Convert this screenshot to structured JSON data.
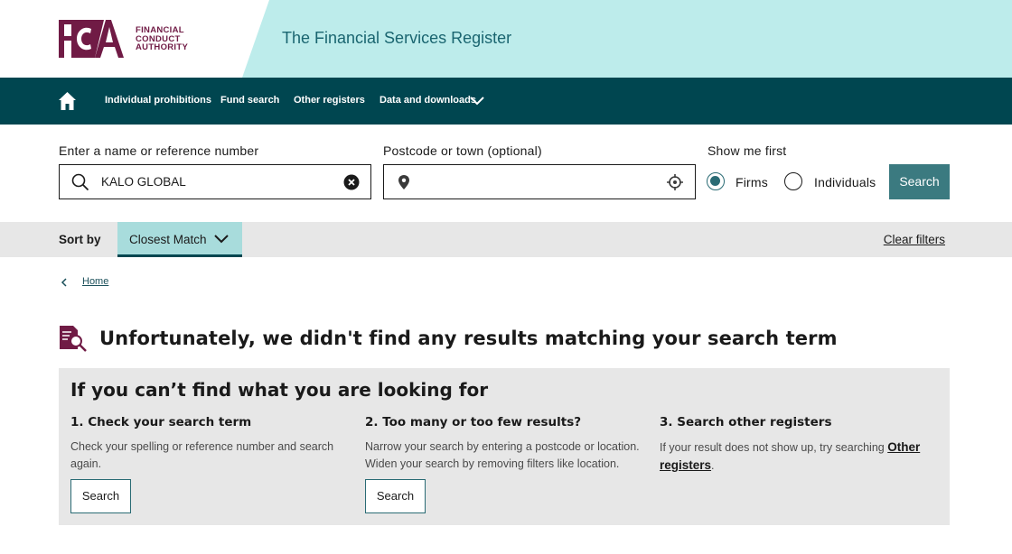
{
  "header": {
    "logo_words": [
      "FINANCIAL",
      "CONDUCT",
      "AUTHORITY"
    ],
    "logo_letters": "FCA",
    "site_title": "The Financial Services Register",
    "brand_color": "#701b45",
    "band_color": "#bdeceb"
  },
  "nav": {
    "home_icon": "home-icon",
    "items": [
      "Individual prohibitions",
      "Fund search",
      "Other registers",
      "Data and downloads"
    ],
    "bg_color": "#004650"
  },
  "search": {
    "name_label": "Enter a name or reference number",
    "name_value": "KALO GLOBAL",
    "postcode_label": "Postcode or town (optional)",
    "postcode_value": "",
    "show_first_label": "Show me first",
    "options": [
      "Firms",
      "Individuals"
    ],
    "selected_option": "Firms",
    "button_label": "Search",
    "button_color": "#3b7a80"
  },
  "sort": {
    "label": "Sort by",
    "selected": "Closest Match",
    "clear_filters": "Clear filters"
  },
  "breadcrumb": {
    "home": "Home"
  },
  "results": {
    "message": "Unfortunately, we didn't find any results matching your search term"
  },
  "help": {
    "title": "If you can’t find what you are looking for",
    "columns": [
      {
        "heading": "1. Check your search term",
        "text": "Check your spelling or reference number and search again.",
        "button": "Search"
      },
      {
        "heading": "2. Too many or too few results?",
        "text": "Narrow your search by entering a postcode or location. Widen your search by removing filters like location.",
        "button": "Search"
      },
      {
        "heading": "3. Search other registers",
        "text_before": "If your result does not show up, try searching ",
        "link": "Other registers",
        "text_after": "."
      }
    ]
  }
}
